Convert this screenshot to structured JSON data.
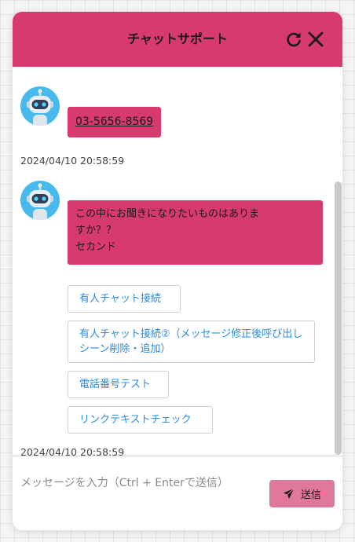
{
  "header": {
    "title": "チャットサポート",
    "refresh_icon": "refresh-icon",
    "close_icon": "close-icon"
  },
  "messages": [
    {
      "type": "link",
      "text": "03-5656-8569",
      "timestamp": "2024/04/10 20:58:59"
    },
    {
      "type": "choices",
      "text_line1": "この中にお聞きになりたいものはありま",
      "text_line2": "すか？？",
      "text_line3": "セカンド",
      "options": [
        "有人チャット接続",
        "有人チャット接続②（メッセージ修正後呼び出しシーン削除・追加）",
        "電話番号テスト",
        "リンクテキストチェック"
      ],
      "timestamp": "2024/04/10 20:58:59"
    }
  ],
  "composer": {
    "placeholder": "メッセージを入力（Ctrl + Enterで送信）",
    "send_label": "送信",
    "send_icon": "paper-plane-icon"
  },
  "colors": {
    "accent": "#d63a6e",
    "send_button": "#e0779c",
    "option_text": "#2a8be0",
    "avatar_bg": "#47b9ec"
  }
}
